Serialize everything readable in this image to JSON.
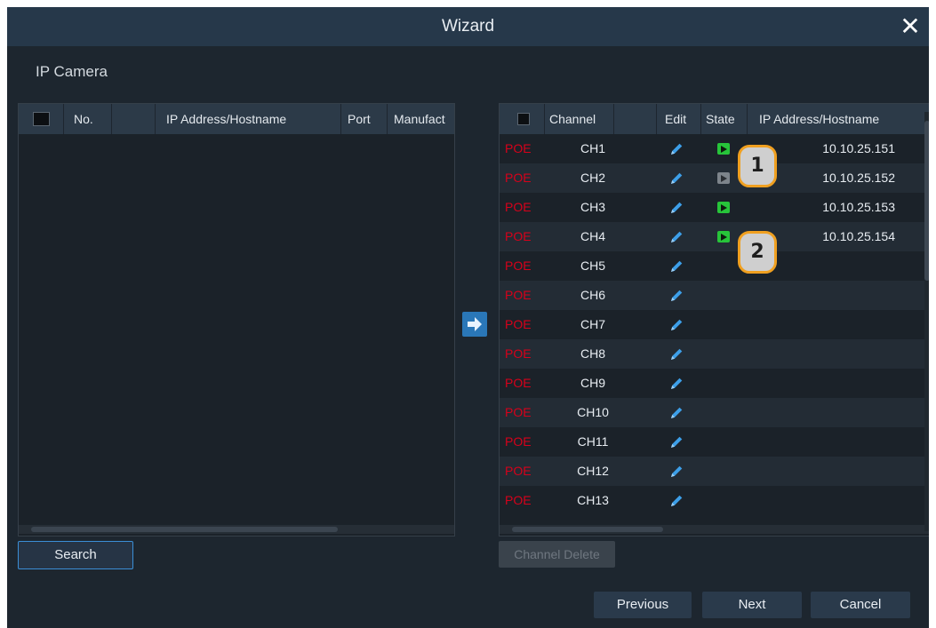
{
  "window": {
    "title": "Wizard",
    "close_glyph": "✕"
  },
  "section": {
    "label": "IP Camera"
  },
  "left_table": {
    "columns": [
      "No.",
      "IP Address/Hostname",
      "Port",
      "Manufact"
    ]
  },
  "right_table": {
    "columns": [
      "Channel",
      "Edit",
      "State",
      "IP Address/Hostname"
    ],
    "rows": [
      {
        "tag": "POE",
        "channel": "CH1",
        "state": "online",
        "ip": "10.10.25.151"
      },
      {
        "tag": "POE",
        "channel": "CH2",
        "state": "offline",
        "ip": "10.10.25.152"
      },
      {
        "tag": "POE",
        "channel": "CH3",
        "state": "online",
        "ip": "10.10.25.153"
      },
      {
        "tag": "POE",
        "channel": "CH4",
        "state": "online",
        "ip": "10.10.25.154"
      },
      {
        "tag": "POE",
        "channel": "CH5",
        "state": "",
        "ip": ""
      },
      {
        "tag": "POE",
        "channel": "CH6",
        "state": "",
        "ip": ""
      },
      {
        "tag": "POE",
        "channel": "CH7",
        "state": "",
        "ip": ""
      },
      {
        "tag": "POE",
        "channel": "CH8",
        "state": "",
        "ip": ""
      },
      {
        "tag": "POE",
        "channel": "CH9",
        "state": "",
        "ip": ""
      },
      {
        "tag": "POE",
        "channel": "CH10",
        "state": "",
        "ip": ""
      },
      {
        "tag": "POE",
        "channel": "CH11",
        "state": "",
        "ip": ""
      },
      {
        "tag": "POE",
        "channel": "CH12",
        "state": "",
        "ip": ""
      },
      {
        "tag": "POE",
        "channel": "CH13",
        "state": "",
        "ip": ""
      }
    ]
  },
  "buttons": {
    "search": "Search",
    "channel_delete": "Channel Delete",
    "previous": "Previous",
    "next": "Next",
    "cancel": "Cancel"
  },
  "callouts": [
    "1",
    "2"
  ],
  "colors": {
    "poe": "#d8001a",
    "state_online": "#27c43a",
    "state_offline": "#7d848b",
    "accent": "#2a77b8",
    "callout_border": "#f0a020"
  },
  "icons": {
    "edit": "pencil-icon",
    "state": "play-icon",
    "add": "arrow-right-icon",
    "close": "close-icon"
  }
}
